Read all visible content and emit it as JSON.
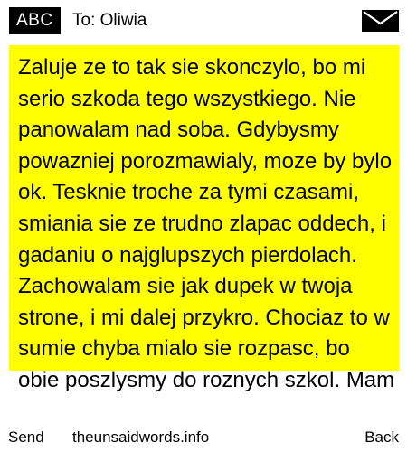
{
  "header": {
    "input_mode": "ABC",
    "recipient": "To: Oliwia",
    "envelope_icon": "envelope-icon"
  },
  "message": {
    "highlight_color": "#ffff00",
    "text": "Zaluje ze to tak sie skonczylo, bo mi serio szkoda tego wszystkiego. Nie panowalam nad soba. Gdybysmy powazniej porozmawialy, moze by bylo ok. Tesknie troche za tymi czasami, smiania sie ze trudno zlapac oddech, i gadaniu o najglupszych pierdolach. Zachowalam sie jak dupek w twoja strone, i mi dalej przykro. Chociaz to w sumie chyba mialo sie rozpasc, bo obie poszlysmy do roznych szkol. Mam"
  },
  "footer": {
    "left_softkey": "Send",
    "center_text": "theunsaidwords.info",
    "right_softkey": "Back"
  }
}
